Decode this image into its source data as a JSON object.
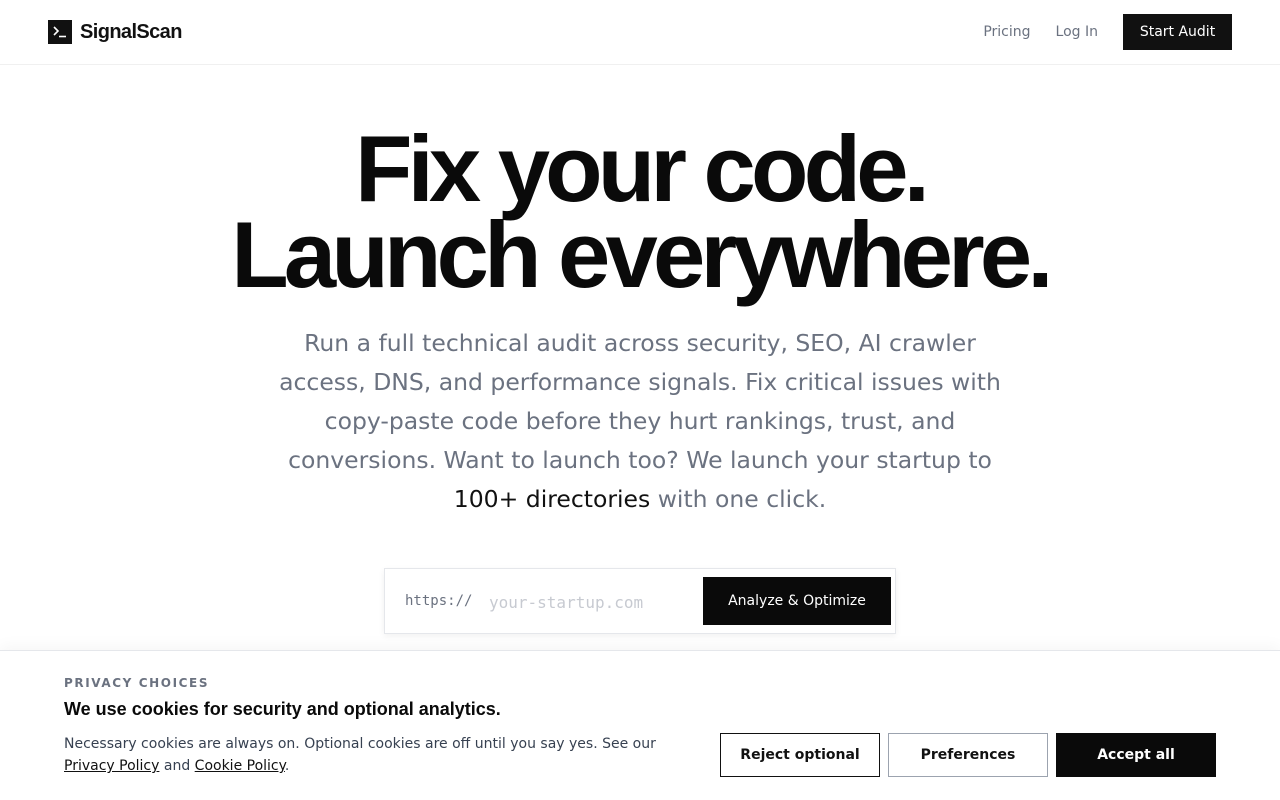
{
  "brand": {
    "name": "SignalScan",
    "logo_icon": "terminal-prompt-icon",
    "accent": "#111111"
  },
  "nav": {
    "pricing": "Pricing",
    "login": "Log In",
    "cta": "Start Audit"
  },
  "hero": {
    "title_line1": "Fix your code.",
    "title_line2": "Launch everywhere.",
    "sub_before": "Run a full technical audit across security, SEO, AI crawler access, DNS, and performance signals. Fix critical issues with copy-paste code before they hurt rankings, trust, and conversions. Want to launch too? We launch your startup to ",
    "sub_highlight": "100+ directories",
    "sub_after": " with one click."
  },
  "url_form": {
    "prefix": "https://",
    "placeholder": "your-startup.com",
    "value": "",
    "button": "Analyze & Optimize"
  },
  "cookie": {
    "eyebrow": "PRIVACY CHOICES",
    "title": "We use cookies for security and optional analytics.",
    "text_before": "Necessary cookies are always on. Optional cookies are off until you say yes. See our ",
    "privacy_link": "Privacy Policy",
    "text_and": " and ",
    "cookie_link": "Cookie Policy",
    "text_end": ".",
    "reject": "Reject optional",
    "preferences": "Preferences",
    "accept": "Accept all"
  }
}
